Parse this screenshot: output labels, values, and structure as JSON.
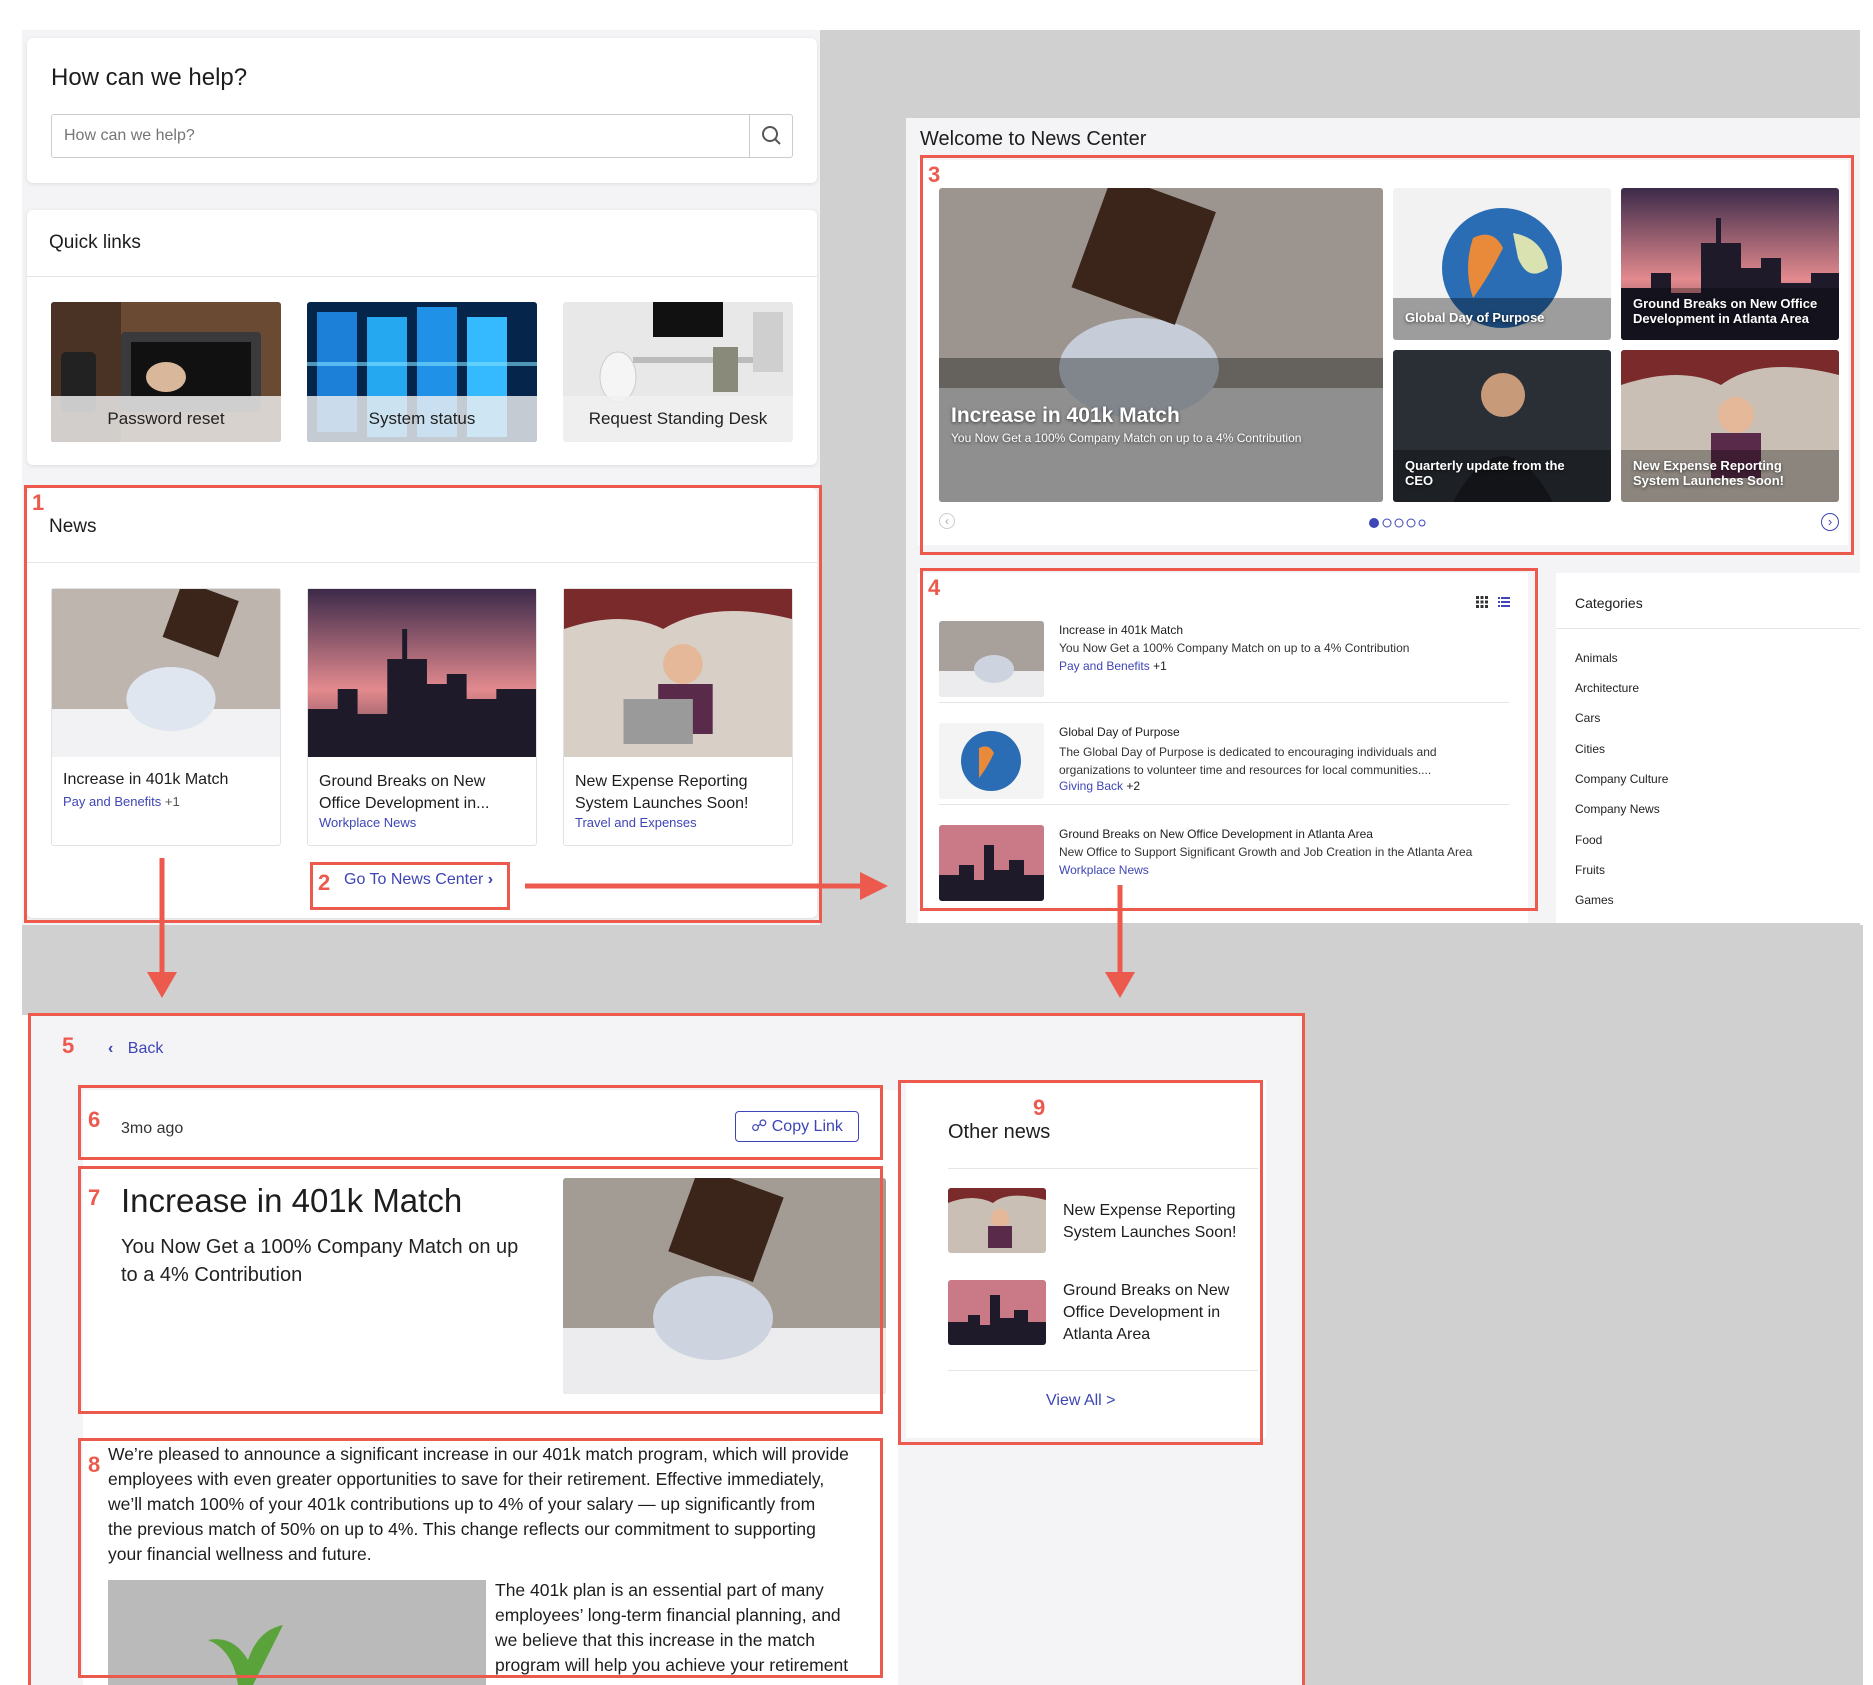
{
  "help": {
    "title": "How can we help?",
    "placeholder": "How can we help?"
  },
  "quick_links": {
    "title": "Quick links",
    "items": [
      {
        "label": "Password reset",
        "icon": "laptop-image"
      },
      {
        "label": "System status",
        "icon": "server-rack-image"
      },
      {
        "label": "Request Standing Desk",
        "icon": "standing-desk-image"
      }
    ]
  },
  "news_widget": {
    "title": "News",
    "cards": [
      {
        "title_l1": "Increase in 401k Match",
        "title_l2": "",
        "tag": "Pay and Benefits",
        "extra": "+1"
      },
      {
        "title_l1": "Ground Breaks on New",
        "title_l2": "Office Development in...",
        "tag": "Workplace News",
        "extra": ""
      },
      {
        "title_l1": "New Expense Reporting",
        "title_l2": "System Launches Soon!",
        "tag": "Travel and Expenses",
        "extra": ""
      }
    ],
    "go_label": "Go To News Center"
  },
  "news_center": {
    "title": "Welcome to News Center",
    "hero": {
      "title": "Increase in 401k Match",
      "subtitle": "You Now Get a 100% Company Match on up to a 4% Contribution"
    },
    "tiles": [
      {
        "l1": "Global Day of Purpose",
        "l2": ""
      },
      {
        "l1": "Ground Breaks on New Office",
        "l2": "Development in Atlanta Area"
      },
      {
        "l1": "Quarterly update from the",
        "l2": "CEO"
      },
      {
        "l1": "New Expense Reporting",
        "l2": "System Launches Soon!"
      }
    ],
    "list": [
      {
        "title": "Increase in 401k Match",
        "desc_l1": "You Now Get a 100% Company Match on up to a 4% Contribution",
        "desc_l2": "",
        "tag": "Pay and Benefits",
        "extra": "+1"
      },
      {
        "title": "Global Day of Purpose",
        "desc_l1": "The Global Day of Purpose is dedicated to encouraging individuals and",
        "desc_l2": "organizations to volunteer time and resources for local communities....",
        "tag": "Giving Back",
        "extra": "+2"
      },
      {
        "title": "Ground Breaks on New Office Development in Atlanta Area",
        "desc_l1": "New Office to Support Significant Growth and Job Creation in the Atlanta Area",
        "desc_l2": "",
        "tag": "Workplace News",
        "extra": ""
      }
    ],
    "categories_title": "Categories",
    "categories": [
      "Animals",
      "Architecture",
      "Cars",
      "Cities",
      "Company Culture",
      "Company News",
      "Food",
      "Fruits",
      "Games"
    ]
  },
  "article": {
    "back": "Back",
    "time": "3mo ago",
    "copy": "Copy Link",
    "title": "Increase in 401k Match",
    "sub_l1": "You Now Get a 100% Company Match on up",
    "sub_l2": "to a 4% Contribution",
    "body": [
      "We’re pleased to announce a significant increase in our 401k match program, which will provide",
      "employees with even greater opportunities to save for their retirement. Effective immediately,",
      "we’ll match 100% of your 401k contributions up to 4% of your salary — up significantly from",
      "the previous match of 50% on up to 4%. This change reflects our commitment to supporting",
      "your financial wellness and future."
    ],
    "body2": [
      "The 401k plan is an essential part of many",
      "employees’ long-term financial planning, and",
      "we believe that this increase in the match",
      "program will help you achieve your retirement"
    ]
  },
  "other_news": {
    "title": "Other news",
    "items": [
      {
        "l1": "New Expense Reporting",
        "l2": "System Launches Soon!",
        "l3": ""
      },
      {
        "l1": "Ground Breaks on New",
        "l2": "Office Development in",
        "l3": "Atlanta Area"
      }
    ],
    "view_all": "View All >"
  },
  "callouts": [
    "1",
    "2",
    "3",
    "4",
    "5",
    "6",
    "7",
    "8",
    "9"
  ],
  "colors": {
    "accent": "#ec5a4e",
    "link": "#3e45b5",
    "panel_bg": "#d0d0d0"
  }
}
